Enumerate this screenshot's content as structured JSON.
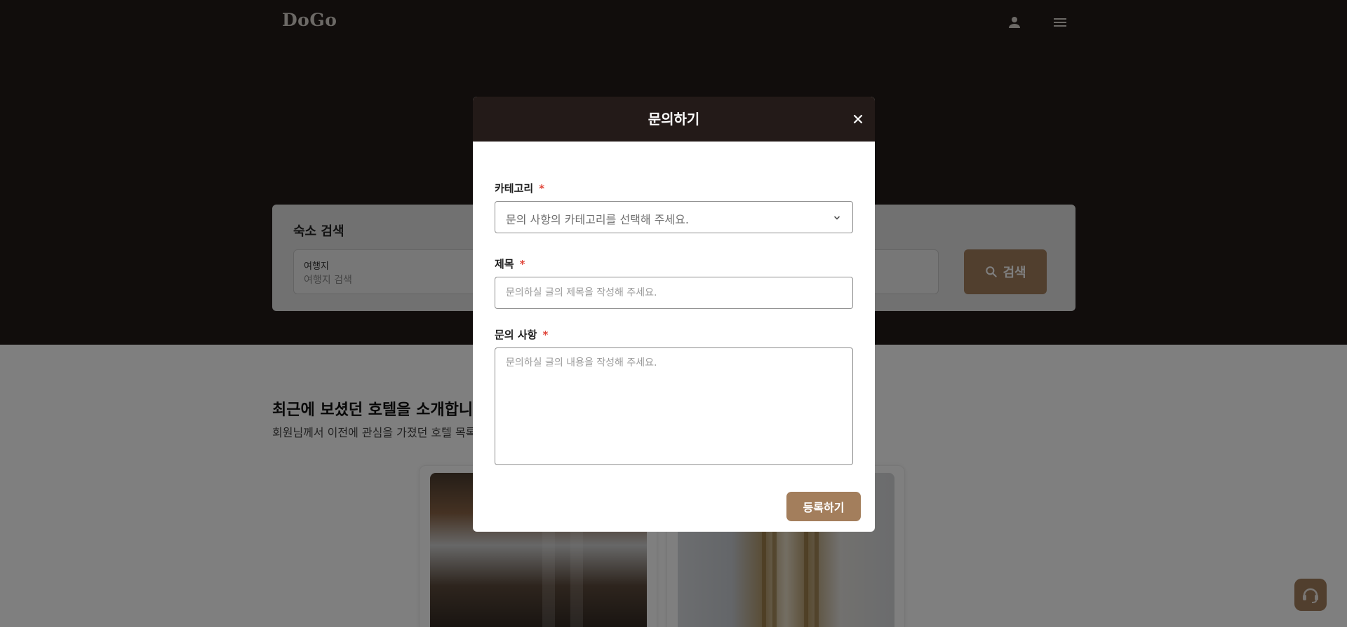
{
  "header": {
    "logo": "DoGo",
    "user_icon": "user-icon",
    "menu_icon": "hamburger-menu-icon"
  },
  "search": {
    "title": "숙소 검색",
    "destination_label": "여행지",
    "destination_placeholder": "여행지 검색",
    "button_label": "검색",
    "button_icon": "search-icon"
  },
  "recent": {
    "title": "최근에 보셨던 호텔을 소개합니다",
    "subtitle": "회원님께서 이전에 관심을 가졌던 호텔 목록"
  },
  "modal": {
    "title": "문의하기",
    "close_icon": "close-icon",
    "category_label": "카테고리",
    "category_placeholder": "문의 사항의 카테고리를 선택해 주세요.",
    "title_label": "제목",
    "title_placeholder": "문의하실 글의 제목을 작성해 주세요.",
    "content_label": "문의 사항",
    "content_placeholder": "문의하실 글의 내용을 작성해 주세요.",
    "required_mark": "*",
    "submit_label": "등록하기"
  },
  "chat_fab": {
    "icon": "headset-support-icon"
  },
  "colors": {
    "hero_bg": "#231b19",
    "accent": "#a37e5c",
    "modal_header": "#231a18",
    "required": "#e0463b"
  }
}
